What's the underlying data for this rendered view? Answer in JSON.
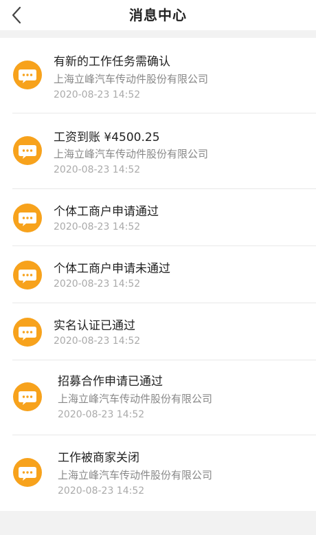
{
  "header": {
    "title": "消息中心",
    "back_icon": "chevron-left-icon"
  },
  "colors": {
    "accent": "#f7a21c",
    "background": "#f2f2f2",
    "card": "#ffffff"
  },
  "messages": [
    {
      "title": "有新的工作任务需确认",
      "company": "上海立峰汽车传动件股份有限公司",
      "time": "2020-08-23 14:52",
      "icon": "chat-bubble-icon"
    },
    {
      "title": "工资到账  ¥4500.25",
      "company": "上海立峰汽车传动件股份有限公司",
      "time": "2020-08-23 14:52",
      "icon": "chat-bubble-icon"
    },
    {
      "title": "个体工商户申请通过",
      "time": "2020-08-23 14:52",
      "icon": "chat-bubble-icon"
    },
    {
      "title": "个体工商户申请未通过",
      "time": "2020-08-23 14:52",
      "icon": "chat-bubble-icon"
    },
    {
      "title": "实名认证已通过",
      "time": "2020-08-23 14:52",
      "icon": "chat-bubble-icon"
    },
    {
      "title": "招募合作申请已通过",
      "company": "上海立峰汽车传动件股份有限公司",
      "time": "2020-08-23 14:52",
      "icon": "chat-bubble-icon"
    },
    {
      "title": "工作被商家关闭",
      "company": "上海立峰汽车传动件股份有限公司",
      "time": "2020-08-23 14:52",
      "icon": "chat-bubble-icon"
    }
  ]
}
